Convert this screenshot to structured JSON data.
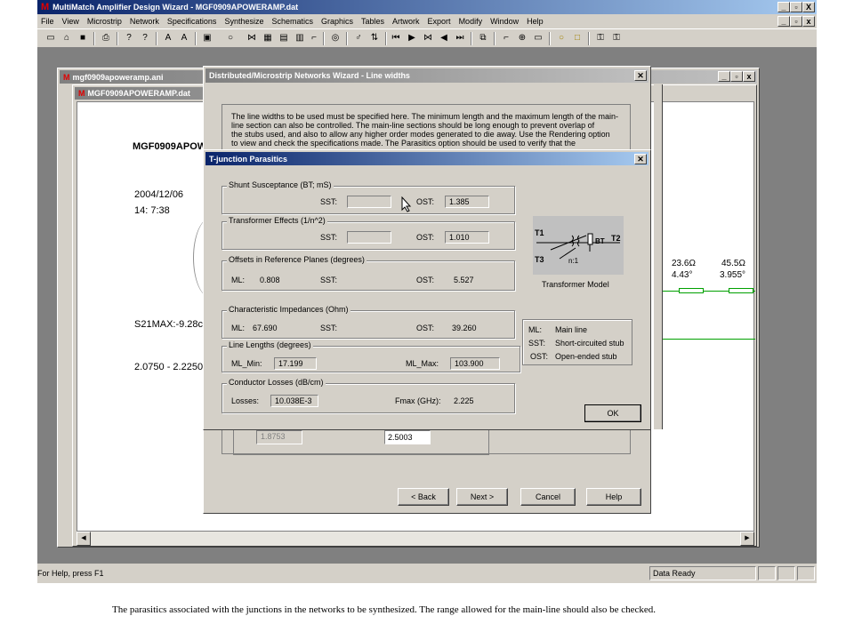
{
  "app": {
    "title": "MultiMatch Amplifier Design Wizard - MGF0909APOWERAMP.dat",
    "title_bar_buttons": [
      "_",
      "▫",
      "X"
    ],
    "menu": [
      "File",
      "View",
      "Microstrip",
      "Network",
      "Specifications",
      "Synthesize",
      "Schematics",
      "Graphics",
      "Tables",
      "Artwork",
      "Export",
      "Modify",
      "Window",
      "Help"
    ]
  },
  "child_window": {
    "title": "mgf0909apoweramp.ani",
    "inner_title": "MGF0909APOWERAMP.dat"
  },
  "doc": {
    "heading": "MGF0909APOW",
    "date": "2004/12/06",
    "time": "14: 7:38",
    "s21": "S21MAX:-9.28c",
    "range": "2.0750 - 2.2250",
    "imp1": "23.6Ω",
    "ang1": "4.43°",
    "imp2": "45.5Ω",
    "ang2": "3.955°"
  },
  "wizard": {
    "title": "Distributed/Microstrip Networks Wizard - Line widths",
    "description": [
      "The line widths to be used must be specified here. The minimum length and the maximum length of the main-",
      "line section can also be controlled. The main-line sections should be long enough to prevent overlap of",
      "the stubs used, and also to allow any higher order modes generated to die away. Use the Rendering option",
      "to view and check the specifications made. The Parasitics option should be used to verify that the"
    ],
    "field_left": "1.8753",
    "field_right": "2.5003",
    "buttons": {
      "back": "< Back",
      "next": "Next >",
      "cancel": "Cancel",
      "help": "Help"
    }
  },
  "tjunction": {
    "title": "T-junction Parasitics",
    "shunt": {
      "label": "Shunt Susceptance (BT; mS)",
      "sst_label": "SST:",
      "sst": "",
      "ost_label": "OST:",
      "ost": "1.385"
    },
    "transformer": {
      "label": "Transformer Effects (1/n^2)",
      "sst_label": "SST:",
      "sst": "",
      "ost_label": "OST:",
      "ost": "1.010"
    },
    "offsets": {
      "label": "Offsets in Reference Planes (degrees)",
      "ml_label": "ML:",
      "ml": "0.808",
      "sst_label": "SST:",
      "sst": "",
      "ost_label": "OST:",
      "ost": "5.527"
    },
    "impedances": {
      "label": "Characteristic Impedances (Ohm)",
      "ml_label": "ML:",
      "ml": "67.690",
      "sst_label": "SST:",
      "sst": "",
      "ost_label": "OST:",
      "ost": "39.260"
    },
    "lengths": {
      "label": "Line Lengths (degrees)",
      "min_label": "ML_Min:",
      "min": "17.199",
      "max_label": "ML_Max:",
      "max": "103.900"
    },
    "losses": {
      "label": "Conductor Losses (dB/cm)",
      "losses_label": "Losses:",
      "losses": "10.038E-3",
      "fmax_label": "Fmax (GHz):",
      "fmax": "2.225"
    },
    "model": {
      "t1": "T1",
      "t2": "T2",
      "t3": "T3",
      "bt": "BT",
      "n": "n:1",
      "caption": "Transformer Model"
    },
    "legend": [
      {
        "key": "ML:",
        "val": "Main line"
      },
      {
        "key": "SST:",
        "val": "Short-circuited stub"
      },
      {
        "key": "OST:",
        "val": "Open-ended stub"
      }
    ],
    "ok": "OK"
  },
  "status": {
    "help": "For Help, press F1",
    "ready": "Data Ready"
  },
  "caption": "The parasitics associated with the junctions in the networks to be synthesized. The range allowed for the main-line should also be checked."
}
